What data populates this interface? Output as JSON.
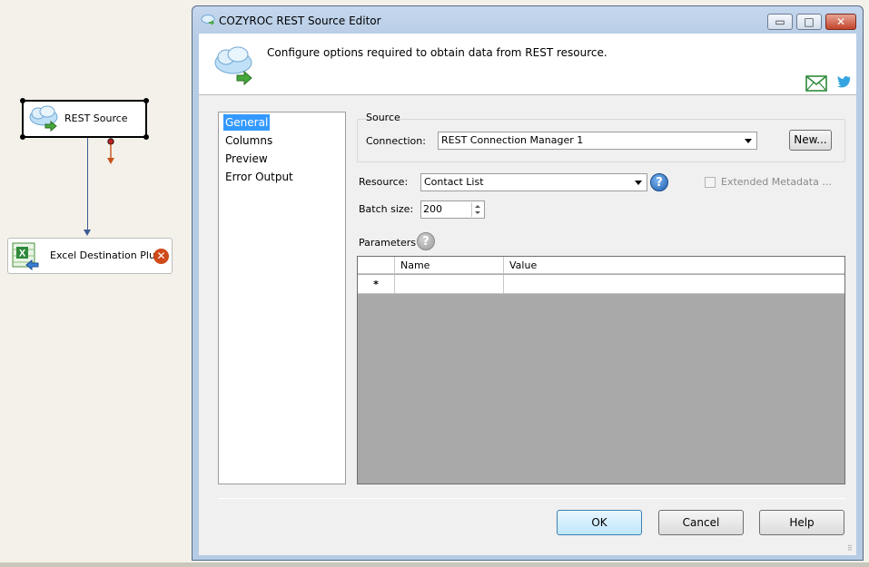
{
  "designer": {
    "rest_node_label": "REST Source",
    "excel_node_label": "Excel Destination Plus"
  },
  "window": {
    "title": "COZYROC REST Source Editor",
    "minimize_glyph": "▭",
    "maximize_glyph": "□",
    "close_glyph": "✕"
  },
  "header": {
    "description": "Configure options required to obtain data from REST resource."
  },
  "nav": {
    "items": [
      {
        "label": "General",
        "selected": true
      },
      {
        "label": "Columns"
      },
      {
        "label": "Preview"
      },
      {
        "label": "Error Output"
      }
    ]
  },
  "source": {
    "group_label": "Source",
    "connection_label": "Connection:",
    "connection_value": "REST Connection Manager 1",
    "new_button": "New..."
  },
  "resource": {
    "label": "Resource:",
    "value": "Contact List",
    "help_glyph": "?",
    "extended_metadata_label": "Extended Metadata ...",
    "extended_metadata_checked": false
  },
  "batch": {
    "label": "Batch size:",
    "value": "200"
  },
  "parameters": {
    "label": "Parameters",
    "help_glyph": "?",
    "columns": [
      "Name",
      "Value"
    ],
    "new_row_marker": "*"
  },
  "buttons": {
    "ok": "OK",
    "cancel": "Cancel",
    "help": "Help"
  },
  "colors": {
    "selection": "#3399ff",
    "grid_background": "#a9a9a9",
    "error_badge": "#d04a1a",
    "connector": "#3e5a96"
  }
}
